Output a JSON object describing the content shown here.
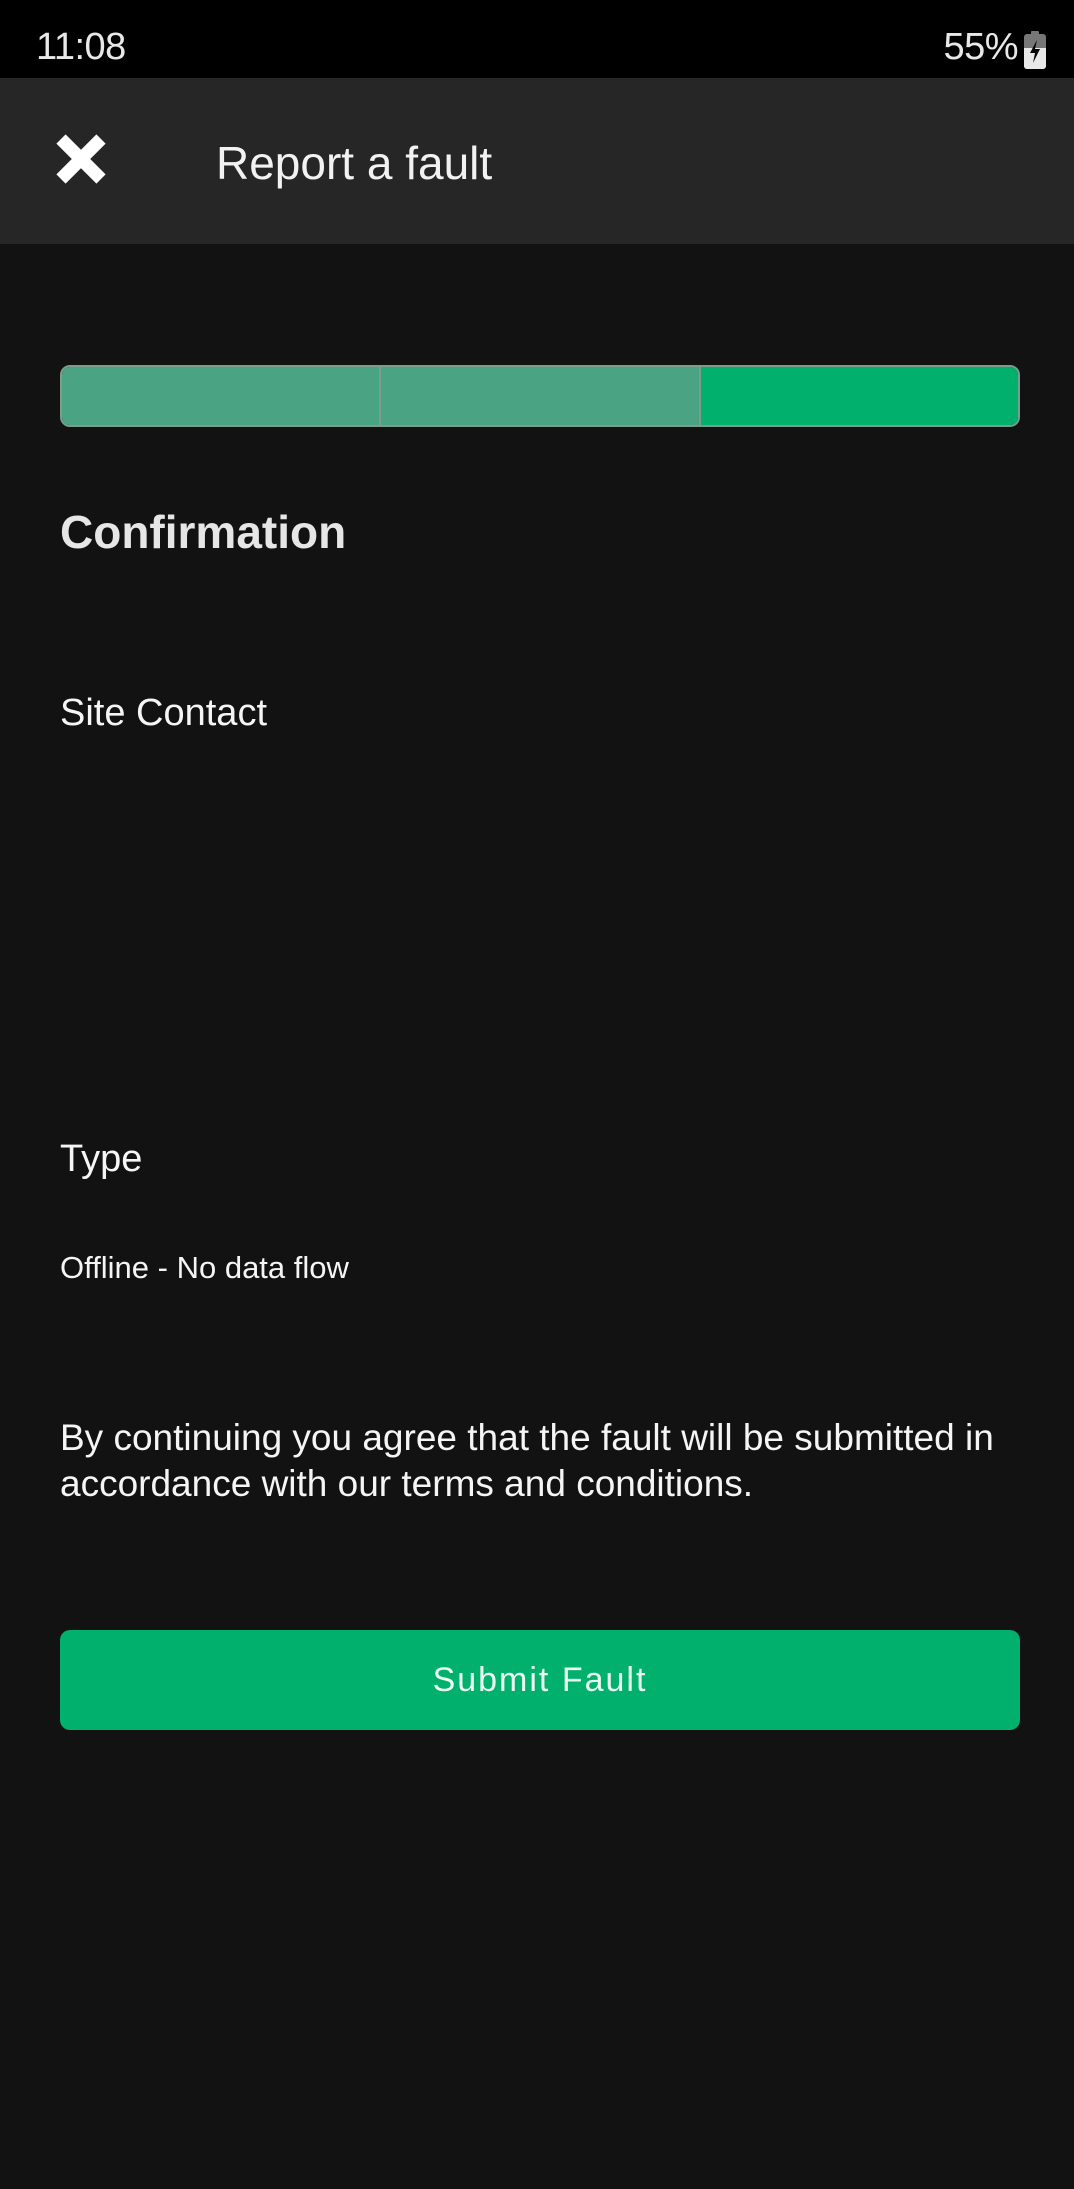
{
  "status_bar": {
    "time": "11:08",
    "battery_percent": "55%",
    "battery_icon": "battery-charging-icon"
  },
  "app_bar": {
    "close_icon": "close-icon",
    "title": "Report a fault"
  },
  "progress": {
    "total_steps": 3,
    "current_step": 3,
    "steps": [
      {
        "state": "completed",
        "color": "#4aa383"
      },
      {
        "state": "completed",
        "color": "#4aa383"
      },
      {
        "state": "active",
        "color": "#00b06c"
      }
    ]
  },
  "content": {
    "section_title": "Confirmation",
    "site_contact_label": "Site Contact",
    "type_label": "Type",
    "type_value": "Offline - No data flow",
    "terms_text": "By continuing you agree that the fault will be submitted in accordance with our terms and conditions."
  },
  "actions": {
    "submit_label": "Submit Fault"
  },
  "colors": {
    "accent": "#00b06c",
    "completed": "#4aa383",
    "background": "#121212",
    "app_bar": "#262626"
  }
}
